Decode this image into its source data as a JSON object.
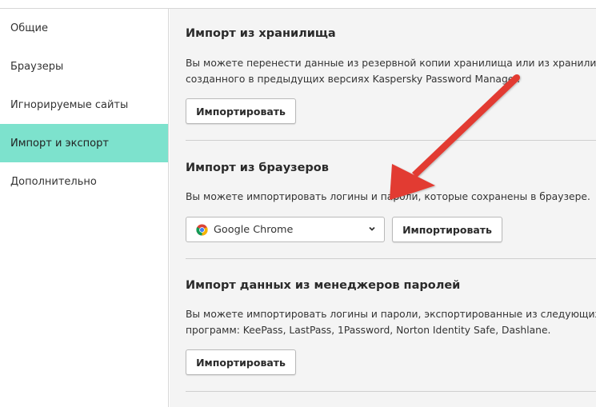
{
  "sidebar": {
    "items": [
      {
        "label": "Общие",
        "active": false
      },
      {
        "label": "Браузеры",
        "active": false
      },
      {
        "label": "Игнорируемые сайты",
        "active": false
      },
      {
        "label": "Импорт и экспорт",
        "active": true
      },
      {
        "label": "Дополнительно",
        "active": false
      }
    ]
  },
  "sections": {
    "storage": {
      "title": "Импорт из хранилища",
      "desc_line1": "Вы можете перенести данные из резервной копии хранилища или из хранилища,",
      "desc_line2": "созданного в предыдущих версиях Kaspersky Password Manager.",
      "button": "Импортировать"
    },
    "browsers": {
      "title": "Импорт из браузеров",
      "desc": "Вы можете импортировать логины и пароли, которые сохранены в браузере.",
      "select_value": "Google Chrome",
      "select_icon": "chrome-icon",
      "button": "Импортировать"
    },
    "managers": {
      "title": "Импорт данных из менеджеров паролей",
      "desc_line1": "Вы можете импортировать логины и пароли, экспортированные из следующих",
      "desc_line2": "программ: KeePass, LastPass, 1Password, Norton Identity Safe, Dashlane.",
      "button": "Импортировать"
    }
  },
  "annotation": {
    "type": "red-arrow",
    "color": "#e23b30",
    "points_to": "browsers.select"
  },
  "colors": {
    "active_nav": "#7de2cd",
    "main_bg": "#f4f4f4",
    "divider": "#cfcfcf"
  }
}
